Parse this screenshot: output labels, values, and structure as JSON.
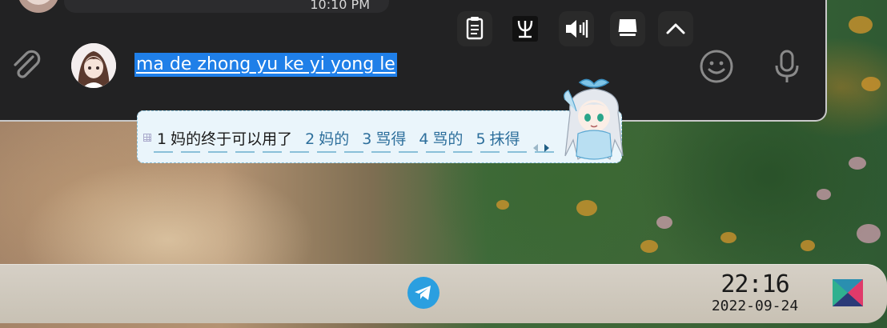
{
  "chat": {
    "message_time": "10:10 PM",
    "input_text": "ma de zhong yu ke yi yong le"
  },
  "ime": {
    "candidates": [
      {
        "num": "1",
        "text": "妈的终于可以用了"
      },
      {
        "num": "2",
        "text": "妈的"
      },
      {
        "num": "3",
        "text": "骂得"
      },
      {
        "num": "4",
        "text": "骂的"
      },
      {
        "num": "5",
        "text": "抹得"
      }
    ]
  },
  "taskbar": {
    "tray_icons": [
      "telegram-icon",
      "clipboard-icon",
      "input-method-icon",
      "volume-icon",
      "drive-icon",
      "expand-tray-icon"
    ],
    "clock_time": "22:16",
    "clock_date": "2022-09-24"
  },
  "colors": {
    "selection": "#1f7fe8",
    "chat_bg": "#222223",
    "candidate_primary": "#1a1a1a",
    "candidate_other": "#2d6f9c",
    "telegram": "#2a9fe0",
    "taskbar": "#d0c9bd"
  }
}
